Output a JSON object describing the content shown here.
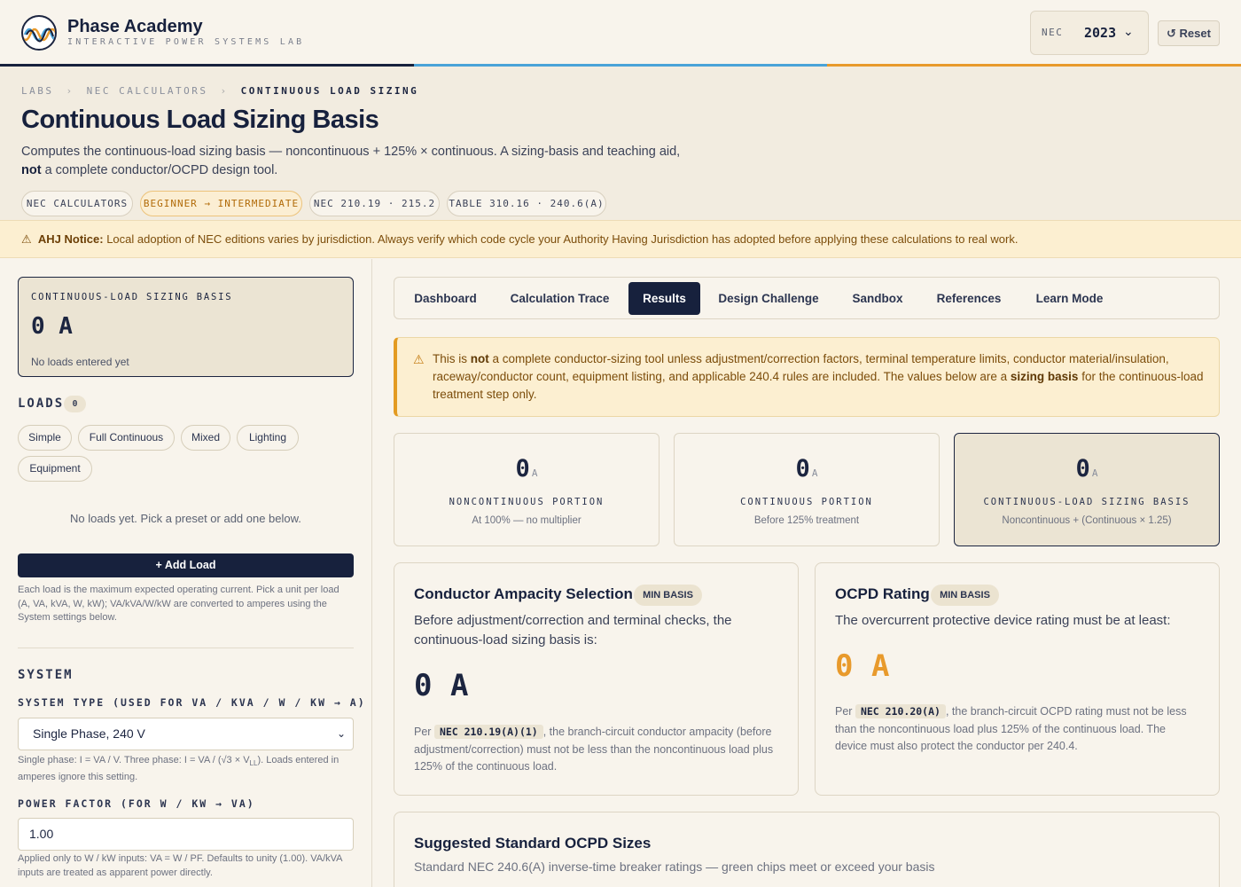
{
  "brand": {
    "name": "Phase Academy",
    "tagline": "INTERACTIVE POWER SYSTEMS LAB"
  },
  "header": {
    "nec_label": "NEC",
    "nec_year": "2023",
    "reset_label": "↺ Reset"
  },
  "colors": {
    "navy": "#17213d",
    "blue": "#4aa3d8",
    "orange": "#e89a2c",
    "cream": "#f8f4ec"
  },
  "breadcrumbs": [
    "LABS",
    "NEC CALCULATORS",
    "CONTINUOUS LOAD SIZING"
  ],
  "page": {
    "title": "Continuous Load Sizing Basis",
    "desc_a": "Computes the continuous-load sizing basis — noncontinuous + 125% × continuous. A sizing-basis and teaching aid,",
    "desc_not": "not",
    "desc_b": " a complete conductor/OCPD design tool."
  },
  "chips": [
    "NEC CALCULATORS",
    "BEGINNER → INTERMEDIATE",
    "NEC 210.19 · 215.2",
    "TABLE 310.16 · 240.6(A)"
  ],
  "notice": {
    "icon": "warning-icon",
    "title": "AHJ Notice:",
    "text": " Local adoption of NEC editions varies by jurisdiction. Always verify which code cycle your Authority Having Jurisdiction has adopted before applying these calculations to real work."
  },
  "sidebar": {
    "summary": {
      "label": "CONTINUOUS-LOAD SIZING BASIS",
      "value": "0 A",
      "sub": "No loads entered yet"
    },
    "loads_title": "LOADS",
    "loads_count": "0",
    "presets": [
      "Simple",
      "Full Continuous",
      "Mixed",
      "Lighting",
      "Equipment"
    ],
    "empty": "No loads yet. Pick a preset or add one below.",
    "add_label": "+ Add Load",
    "add_hint": "Each load is the maximum expected operating current. Pick a unit per load (A, VA, kVA, W, kW); VA/kVA/W/kW are converted to amperes using the System settings below.",
    "system_title": "SYSTEM",
    "system_type_label": "SYSTEM TYPE (USED FOR VA / KVA / W / KW → A)",
    "system_type_value": "Single Phase, 240 V",
    "system_hint_a": "Single phase: I = VA / V. Three phase: I = VA / (√3 × V",
    "system_hint_sub": "LL",
    "system_hint_b": "). Loads entered in amperes ignore this setting.",
    "pf_label": "POWER FACTOR (FOR W / KW → VA)",
    "pf_value": "1.00",
    "pf_hint": "Applied only to W / kW inputs: VA = W / PF. Defaults to unity (1.00). VA/kVA inputs are treated as apparent power directly."
  },
  "tabs": [
    "Dashboard",
    "Calculation Trace",
    "Results",
    "Design Challenge",
    "Sandbox",
    "References",
    "Learn Mode"
  ],
  "active_tab": "Results",
  "warning": {
    "a": "This is ",
    "not": "not",
    "b": " a complete conductor-sizing tool unless adjustment/correction factors, terminal temperature limits, conductor material/insulation, raceway/conductor count, equipment listing, and applicable 240.4 rules are included. The values below are a ",
    "bold": "sizing basis",
    "c": " for the continuous-load treatment step only."
  },
  "stats": [
    {
      "value": "0",
      "unit": "A",
      "label": "NONCONTINUOUS PORTION",
      "sub": "At 100% — no multiplier"
    },
    {
      "value": "0",
      "unit": "A",
      "label": "CONTINUOUS PORTION",
      "sub": "Before 125% treatment"
    },
    {
      "value": "0",
      "unit": "A",
      "label": "CONTINUOUS-LOAD SIZING BASIS",
      "sub": "Noncontinuous + (Continuous × 1.25)"
    }
  ],
  "conductor": {
    "title": "Conductor Ampacity Selection",
    "badge": "MIN BASIS",
    "lead": "Before adjustment/correction and terminal checks, the continuous-load sizing basis is:",
    "value": "0 A",
    "para_a": "Per ",
    "code": "NEC 210.19(A)(1)",
    "para_b": ", the branch-circuit conductor ampacity (before adjustment/correction) must not be less than the noncontinuous load plus 125% of the continuous load."
  },
  "ocpd": {
    "title": "OCPD Rating",
    "badge": "MIN BASIS",
    "lead": "The overcurrent protective device rating must be at least:",
    "value": "0 A",
    "para_a": "Per ",
    "code": "NEC 210.20(A)",
    "para_b": ", the branch-circuit OCPD rating must not be less than the noncontinuous load plus 125% of the continuous load. The device must also protect the conductor per 240.4."
  },
  "sizes": {
    "title": "Suggested Standard OCPD Sizes",
    "sub": "Standard NEC 240.6(A) inverse-time breaker ratings — green chips meet or exceed your basis"
  }
}
